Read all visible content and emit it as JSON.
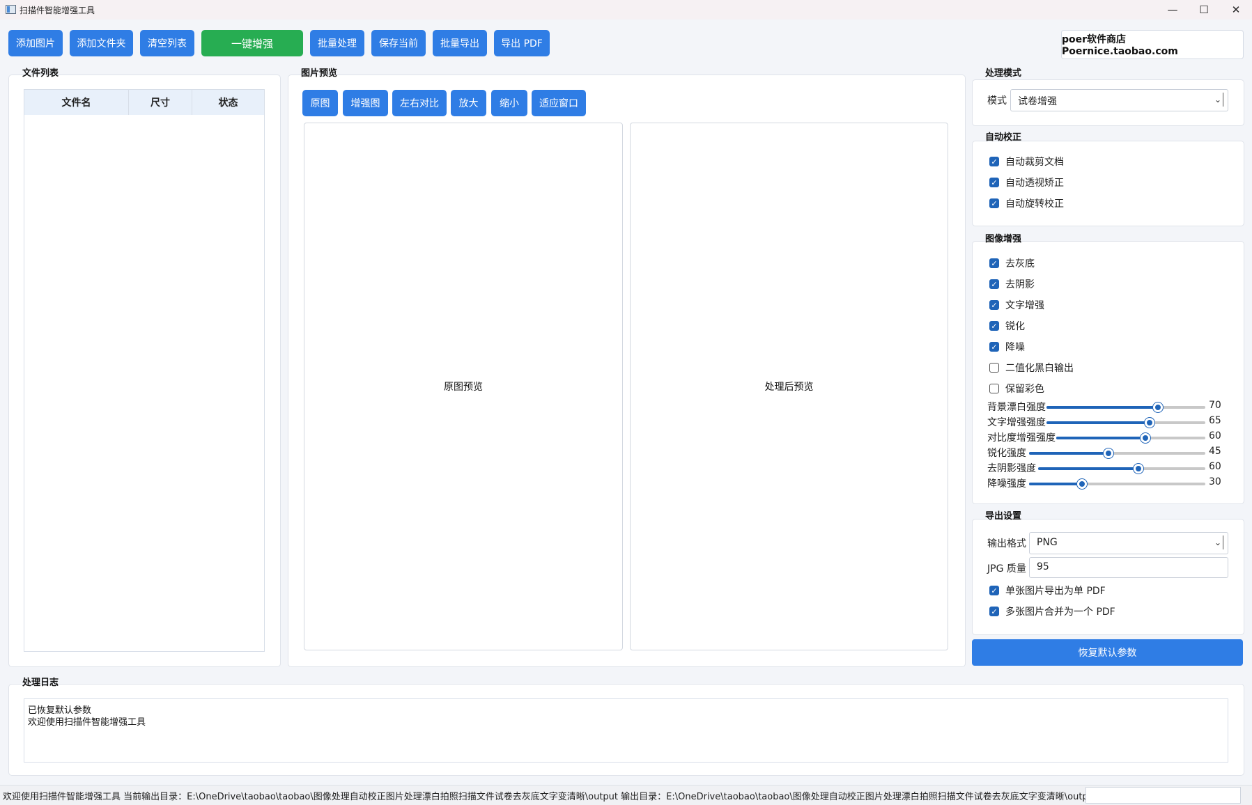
{
  "window": {
    "title": "扫描件智能增强工具",
    "minimize": "—",
    "maximize": "☐",
    "close": "✕"
  },
  "toolbar": {
    "add_images": "添加图片",
    "add_folder": "添加文件夹",
    "clear_list": "清空列表",
    "one_click": "一键增强",
    "batch_process": "批量处理",
    "save_current": "保存当前",
    "batch_export": "批量导出",
    "export_pdf": "导出 PDF",
    "shop": "poer软件商店  Poernice.taobao.com"
  },
  "file_list": {
    "title": "文件列表",
    "columns": [
      "文件名",
      "尺寸",
      "状态"
    ],
    "rows": []
  },
  "preview": {
    "title": "图片预览",
    "buttons": [
      "原图",
      "增强图",
      "左右对比",
      "放大",
      "缩小",
      "适应窗口"
    ],
    "original_label": "原图预览",
    "processed_label": "处理后预览"
  },
  "mode": {
    "title": "处理模式",
    "label": "模式",
    "value": "试卷增强"
  },
  "auto_correct": {
    "title": "自动校正",
    "items": [
      {
        "label": "自动裁剪文档",
        "checked": true
      },
      {
        "label": "自动透视矫正",
        "checked": true
      },
      {
        "label": "自动旋转校正",
        "checked": true
      }
    ]
  },
  "enhance": {
    "title": "图像增强",
    "items": [
      {
        "label": "去灰底",
        "checked": true
      },
      {
        "label": "去阴影",
        "checked": true
      },
      {
        "label": "文字增强",
        "checked": true
      },
      {
        "label": "锐化",
        "checked": true
      },
      {
        "label": "降噪",
        "checked": true
      },
      {
        "label": "二值化黑白输出",
        "checked": false
      },
      {
        "label": "保留彩色",
        "checked": false
      }
    ],
    "sliders": [
      {
        "label": "背景漂白强度",
        "value": "70"
      },
      {
        "label": "文字增强强度",
        "value": "65"
      },
      {
        "label": "对比度增强强度",
        "value": "60"
      },
      {
        "label": "锐化强度",
        "value": "45"
      },
      {
        "label": "去阴影强度",
        "value": "60"
      },
      {
        "label": "降噪强度",
        "value": "30"
      }
    ]
  },
  "export": {
    "title": "导出设置",
    "format_label": "输出格式",
    "format_value": "PNG",
    "quality_label": "JPG 质量",
    "quality_value": "95",
    "single_pdf": "单张图片导出为单 PDF",
    "merge_pdf": "多张图片合并为一个 PDF",
    "single_pdf_checked": true,
    "merge_pdf_checked": true
  },
  "restore_button": "恢复默认参数",
  "log": {
    "title": "处理日志",
    "lines": [
      "已恢复默认参数",
      "欢迎使用扫描件智能增强工具"
    ]
  },
  "status": {
    "text": "欢迎使用扫描件智能增强工具    当前输出目录：E:\\OneDrive\\taobao\\taobao\\图像处理自动校正图片处理漂白拍照扫描文件试卷去灰底文字变清晰\\output  输出目录：E:\\OneDrive\\taobao\\taobao\\图像处理自动校正图片处理漂白拍照扫描文件试卷去灰底文字变清晰\\output"
  },
  "colors": {
    "accent": "#2f7de5",
    "green": "#27ad52",
    "check": "#1f64b8"
  }
}
